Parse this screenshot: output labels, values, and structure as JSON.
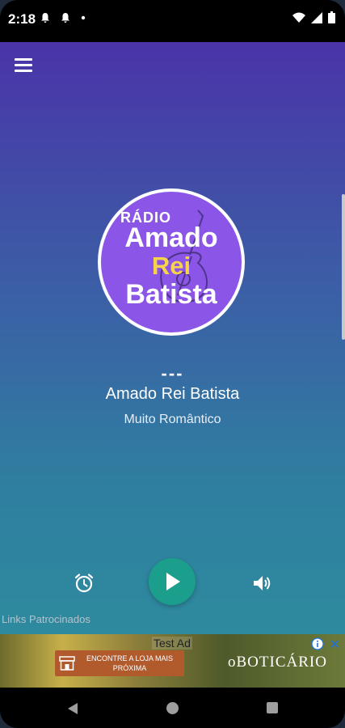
{
  "status_bar": {
    "time": "2:18",
    "left_icons": [
      "notification-bell-icon",
      "notification-bell-icon",
      "dot-icon"
    ],
    "right_icons": [
      "wifi-icon",
      "signal-icon",
      "battery-icon"
    ]
  },
  "theme": {
    "gradient_top": "#4a34a8",
    "gradient_bottom": "#2e8a9e",
    "play_button_color": "#1b9f8c"
  },
  "logo": {
    "line_radio": "RÁDIO",
    "line1": "Amado",
    "line2": "Rei",
    "line3": "Batista"
  },
  "player": {
    "track": "---",
    "station_name": "Amado Rei Batista",
    "genre": "Muito Romântico"
  },
  "controls": {
    "alarm_icon": "alarm-clock-icon",
    "play_icon": "play-icon",
    "volume_icon": "volume-icon"
  },
  "sponsored_label": "Links Patrocinados",
  "ad": {
    "label": "Test Ad",
    "cta": "ENCONTRE A LOJA MAIS PRÓXIMA",
    "brand": "oBOTICÁRIO"
  }
}
